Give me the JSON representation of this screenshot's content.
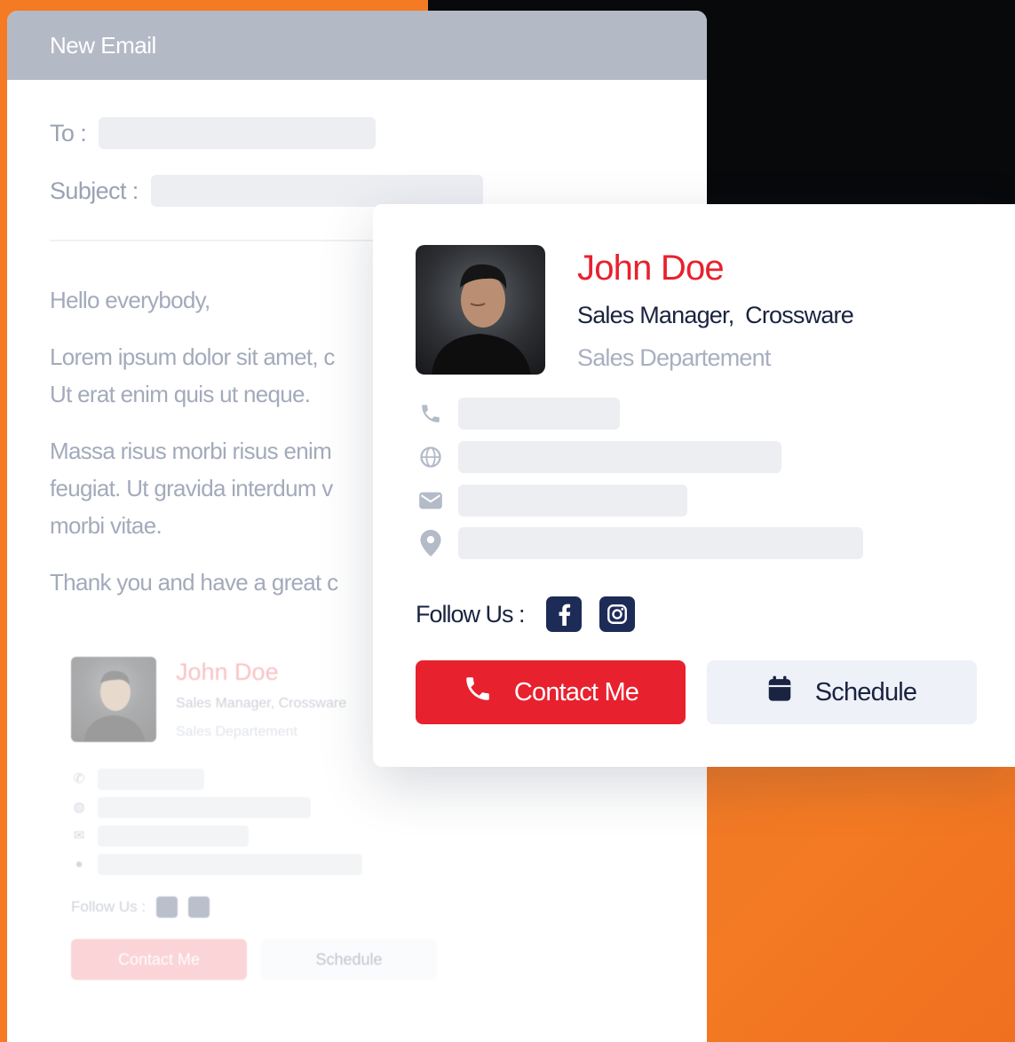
{
  "email": {
    "window_title": "New Email",
    "to_label": "To :",
    "subject_label": "Subject :",
    "paragraphs": [
      "Hello everybody,",
      "Lorem ipsum dolor sit amet, c",
      "Ut erat enim quis ut neque.",
      "Massa risus morbi risus enim",
      "feugiat. Ut gravida interdum v",
      "morbi vitae.",
      "Thank you and have a great c"
    ]
  },
  "signature": {
    "name": "John Doe",
    "title": "Sales Manager,",
    "company": "Crossware",
    "department": "Sales Departement",
    "follow_label": "Follow Us :",
    "contact_button": "Contact Me",
    "schedule_button": "Schedule",
    "icons": {
      "phone": "phone-icon",
      "web": "globe-icon",
      "email": "mail-icon",
      "location": "location-pin-icon",
      "facebook": "facebook-icon",
      "instagram": "instagram-icon",
      "calendar": "calendar-icon"
    }
  },
  "small_signature": {
    "name": "John Doe",
    "title": "Sales Manager, Crossware",
    "department": "Sales Departement",
    "follow_label": "Follow Us :",
    "contact_button": "Contact Me",
    "schedule_button": "Schedule"
  },
  "colors": {
    "accent_red": "#e8212e",
    "navy": "#1a2340",
    "orange_bg": "#f47a23",
    "header_gray": "#b4b9c6"
  }
}
